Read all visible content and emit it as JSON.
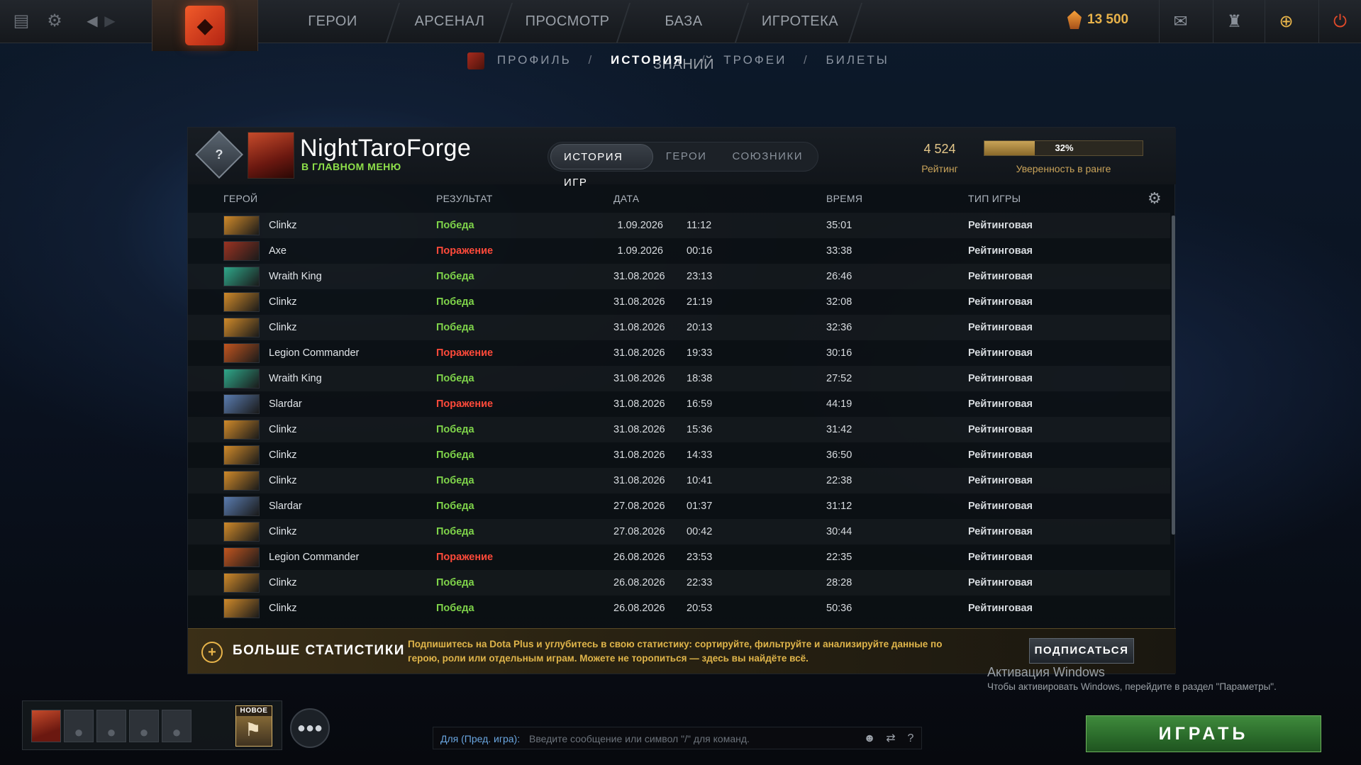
{
  "topnav": {
    "items": [
      "ГЕРОИ",
      "АРСЕНАЛ",
      "ПРОСМОТР",
      "БАЗА ЗНАНИЙ",
      "ИГРОТЕКА"
    ],
    "currency_amount": "13 500"
  },
  "subnav": {
    "items": [
      "ПРОФИЛЬ",
      "ИСТОРИЯ",
      "ТРОФЕИ",
      "БИЛЕТЫ"
    ],
    "active_index": 1
  },
  "profile": {
    "rank_badge": "?",
    "name": "NightTaroForge",
    "status": "В ГЛАВНОМ МЕНЮ",
    "rating_value": "4 524",
    "rating_label": "Рейтинг",
    "confidence_percent": 32,
    "confidence_text": "32%",
    "confidence_label": "Уверенность в ранге"
  },
  "tabs": [
    "ИСТОРИЯ ИГР",
    "ГЕРОИ",
    "СОЮЗНИКИ"
  ],
  "columns": {
    "hero": "ГЕРОЙ",
    "result": "РЕЗУЛЬТАТ",
    "date": "ДАТА",
    "duration": "ВРЕМЯ",
    "game_type": "ТИП ИГРЫ"
  },
  "matches": [
    {
      "hero": "Clinkz",
      "result": "Победа",
      "win": true,
      "date": "1.09.2026",
      "time": "11:12",
      "duration": "35:01",
      "type": "Рейтинговая"
    },
    {
      "hero": "Axe",
      "result": "Поражение",
      "win": false,
      "date": "1.09.2026",
      "time": "00:16",
      "duration": "33:38",
      "type": "Рейтинговая"
    },
    {
      "hero": "Wraith King",
      "result": "Победа",
      "win": true,
      "date": "31.08.2026",
      "time": "23:13",
      "duration": "26:46",
      "type": "Рейтинговая"
    },
    {
      "hero": "Clinkz",
      "result": "Победа",
      "win": true,
      "date": "31.08.2026",
      "time": "21:19",
      "duration": "32:08",
      "type": "Рейтинговая"
    },
    {
      "hero": "Clinkz",
      "result": "Победа",
      "win": true,
      "date": "31.08.2026",
      "time": "20:13",
      "duration": "32:36",
      "type": "Рейтинговая"
    },
    {
      "hero": "Legion Commander",
      "result": "Поражение",
      "win": false,
      "date": "31.08.2026",
      "time": "19:33",
      "duration": "30:16",
      "type": "Рейтинговая"
    },
    {
      "hero": "Wraith King",
      "result": "Победа",
      "win": true,
      "date": "31.08.2026",
      "time": "18:38",
      "duration": "27:52",
      "type": "Рейтинговая"
    },
    {
      "hero": "Slardar",
      "result": "Поражение",
      "win": false,
      "date": "31.08.2026",
      "time": "16:59",
      "duration": "44:19",
      "type": "Рейтинговая"
    },
    {
      "hero": "Clinkz",
      "result": "Победа",
      "win": true,
      "date": "31.08.2026",
      "time": "15:36",
      "duration": "31:42",
      "type": "Рейтинговая"
    },
    {
      "hero": "Clinkz",
      "result": "Победа",
      "win": true,
      "date": "31.08.2026",
      "time": "14:33",
      "duration": "36:50",
      "type": "Рейтинговая"
    },
    {
      "hero": "Clinkz",
      "result": "Победа",
      "win": true,
      "date": "31.08.2026",
      "time": "10:41",
      "duration": "22:38",
      "type": "Рейтинговая"
    },
    {
      "hero": "Slardar",
      "result": "Победа",
      "win": true,
      "date": "27.08.2026",
      "time": "01:37",
      "duration": "31:12",
      "type": "Рейтинговая"
    },
    {
      "hero": "Clinkz",
      "result": "Победа",
      "win": true,
      "date": "27.08.2026",
      "time": "00:42",
      "duration": "30:44",
      "type": "Рейтинговая"
    },
    {
      "hero": "Legion Commander",
      "result": "Поражение",
      "win": false,
      "date": "26.08.2026",
      "time": "23:53",
      "duration": "22:35",
      "type": "Рейтинговая"
    },
    {
      "hero": "Clinkz",
      "result": "Победа",
      "win": true,
      "date": "26.08.2026",
      "time": "22:33",
      "duration": "28:28",
      "type": "Рейтинговая"
    },
    {
      "hero": "Clinkz",
      "result": "Победа",
      "win": true,
      "date": "26.08.2026",
      "time": "20:53",
      "duration": "50:36",
      "type": "Рейтинговая"
    }
  ],
  "promo": {
    "title": "БОЛЬШЕ СТАТИСТИКИ",
    "text": "Подпишитесь на Dota Plus и углубитесь в свою статистику: сортируйте, фильтруйте и анализируйте данные по герою, роли или отдельным играм. Можете не торопиться — здесь вы найдёте всё.",
    "button": "ПОДПИСАТЬСЯ"
  },
  "activation": {
    "title": "Активация Windows",
    "text": "Чтобы активировать Windows, перейдите в раздел \"Параметры\"."
  },
  "party": {
    "new_badge": "НОВОЕ"
  },
  "chat": {
    "to_label": "Для (Пред. игра):",
    "placeholder": "Введите сообщение или символ \"/\" для команд."
  },
  "play_button": "ИГРАТЬ",
  "colors": {
    "win": "#7fd44a",
    "loss": "#ff4a3a",
    "accent": "#e8b44a",
    "play": "#3f8a3c"
  },
  "hero_colors": {
    "Clinkz": "#d08a2a",
    "Axe": "#9b3322",
    "Wraith King": "#2fa88a",
    "Legion Commander": "#c2551f",
    "Slardar": "#5a7cb0"
  }
}
